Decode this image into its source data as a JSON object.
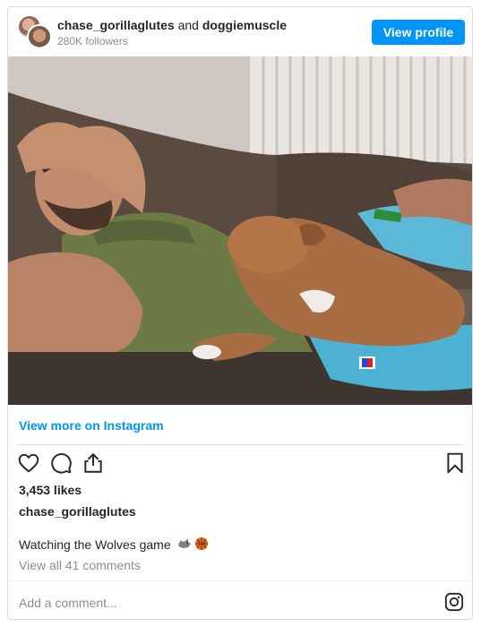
{
  "header": {
    "user1": "chase_gorillaglutes",
    "connector": "and",
    "user2": "doggiemuscle",
    "followers": "280K followers",
    "view_profile_label": "View profile"
  },
  "post": {
    "view_more_label": "View more on Instagram",
    "likes": "3,453 likes",
    "owner": "chase_gorillaglutes",
    "caption": "Watching the Wolves game",
    "caption_emoji": [
      "wolf-icon",
      "basketball-icon"
    ],
    "comments_link": "View all 41 comments"
  },
  "comment_box": {
    "placeholder": "Add a comment..."
  },
  "colors": {
    "accent": "#0095f6",
    "text": "#262626",
    "muted": "#8e8e8e",
    "border": "#dbdbdb"
  }
}
